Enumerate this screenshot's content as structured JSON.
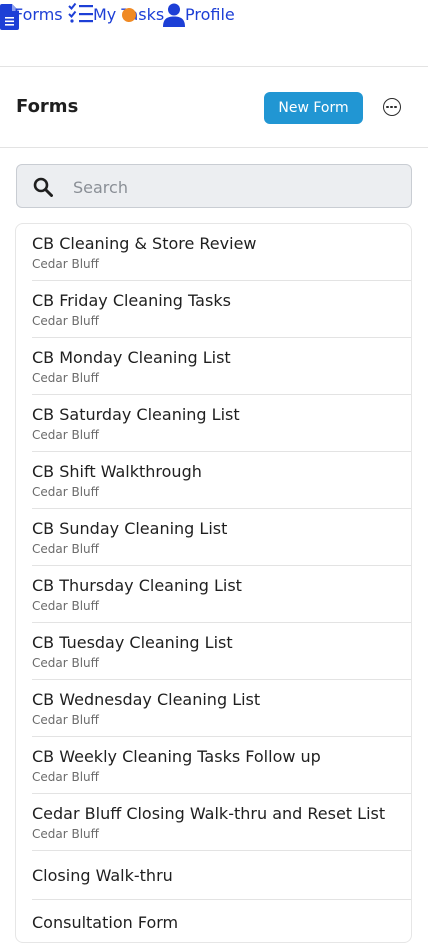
{
  "nav": {
    "forms": "Forms",
    "tasks": "My Tasks",
    "tasks_badge": "",
    "profile": "Profile"
  },
  "header": {
    "title": "Forms",
    "new_form": "New Form"
  },
  "search": {
    "placeholder": "Search"
  },
  "forms": [
    {
      "title": "CB Cleaning & Store Review",
      "location": "Cedar Bluff"
    },
    {
      "title": "CB Friday Cleaning Tasks",
      "location": "Cedar Bluff"
    },
    {
      "title": "CB Monday Cleaning List",
      "location": "Cedar Bluff"
    },
    {
      "title": "CB Saturday Cleaning List",
      "location": "Cedar Bluff"
    },
    {
      "title": "CB Shift Walkthrough",
      "location": "Cedar Bluff"
    },
    {
      "title": "CB Sunday Cleaning List",
      "location": "Cedar Bluff"
    },
    {
      "title": "CB Thursday Cleaning List",
      "location": "Cedar Bluff"
    },
    {
      "title": "CB Tuesday Cleaning List",
      "location": "Cedar Bluff"
    },
    {
      "title": "CB Wednesday Cleaning List",
      "location": "Cedar Bluff"
    },
    {
      "title": "CB Weekly Cleaning Tasks Follow up",
      "location": "Cedar Bluff"
    },
    {
      "title": "Cedar Bluff Closing Walk-thru and Reset List",
      "location": "Cedar Bluff"
    },
    {
      "title": "Closing Walk-thru",
      "location": ""
    },
    {
      "title": "Consultation Form",
      "location": ""
    }
  ],
  "colors": {
    "link": "#1d3fd6",
    "primary": "#2196d3",
    "badge": "#f08a24"
  }
}
